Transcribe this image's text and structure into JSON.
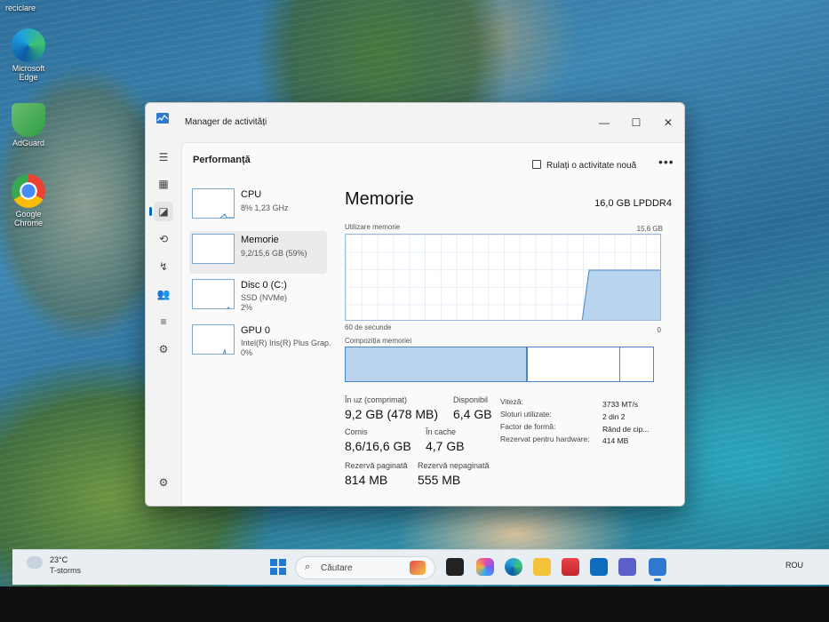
{
  "desktop": {
    "icons": [
      {
        "label": "reciclare"
      },
      {
        "label": "Microsoft Edge"
      },
      {
        "label": "AdGuard"
      },
      {
        "label": "Google Chrome"
      }
    ]
  },
  "window": {
    "title": "Manager de activități",
    "controls": {
      "minimize": "—",
      "maximize": "☐",
      "close": "✕"
    }
  },
  "rail": {
    "items": [
      {
        "name": "menu",
        "glyph": "☰"
      },
      {
        "name": "processes",
        "glyph": "▦"
      },
      {
        "name": "performance",
        "glyph": "◪"
      },
      {
        "name": "app-history",
        "glyph": "⟲"
      },
      {
        "name": "startup",
        "glyph": "↯"
      },
      {
        "name": "users",
        "glyph": "👥"
      },
      {
        "name": "details",
        "glyph": "≡"
      },
      {
        "name": "services",
        "glyph": "⚙"
      }
    ],
    "settings_glyph": "⚙"
  },
  "header": {
    "page_title": "Performanță",
    "run_task_label": "Rulați o activitate nouă",
    "more_label": "•••"
  },
  "perf_list": [
    {
      "name": "CPU",
      "sub1": "8%  1,23 GHz",
      "sub2": "",
      "level": 0.08
    },
    {
      "name": "Memorie",
      "sub1": "9,2/15,6 GB (59%)",
      "sub2": "",
      "level": 0.59
    },
    {
      "name": "Disc 0 (C:)",
      "sub1": "SSD (NVMe)",
      "sub2": "2%",
      "level": 0.02
    },
    {
      "name": "GPU 0",
      "sub1": "Intel(R) Iris(R) Plus Grap.",
      "sub2": "0%",
      "level": 0.0
    }
  ],
  "detail": {
    "title": "Memorie",
    "spec": "16,0 GB LPDDR4",
    "usage_label": "Utilizare memorie",
    "usage_max": "15,6 GB",
    "time_left": "60 de secunde",
    "time_right": "0",
    "composition_label": "Compoziția memoriei",
    "composition": {
      "in_use": 0.59,
      "modified": 0.0,
      "standby": 0.3,
      "free": 0.11
    },
    "stats": {
      "in_use_label": "În uz (comprimat)",
      "in_use_value": "9,2 GB (478 MB)",
      "available_label": "Disponibil",
      "available_value": "6,4 GB",
      "committed_label": "Comis",
      "committed_value": "8,6/16,6 GB",
      "cached_label": "În cache",
      "cached_value": "4,7 GB",
      "paged_label": "Rezervă paginată",
      "paged_value": "814 MB",
      "nonpaged_label": "Rezervă nepaginată",
      "nonpaged_value": "555 MB"
    },
    "properties": [
      {
        "label": "Viteză:",
        "value": "3733 MT/s"
      },
      {
        "label": "Sloturi utilizate:",
        "value": "2 din 2"
      },
      {
        "label": "Factor de formă:",
        "value": "Rând de cip..."
      },
      {
        "label": "Rezervat pentru hardware:",
        "value": "414 MB"
      }
    ]
  },
  "taskbar": {
    "weather_temp": "23°C",
    "weather_desc": "T-storms",
    "search_placeholder": "Căutare",
    "language": "ROU"
  },
  "colors": {
    "accent": "#0067c0",
    "memory_fill": "#b8d4ee",
    "memory_line": "#4a86c5"
  }
}
